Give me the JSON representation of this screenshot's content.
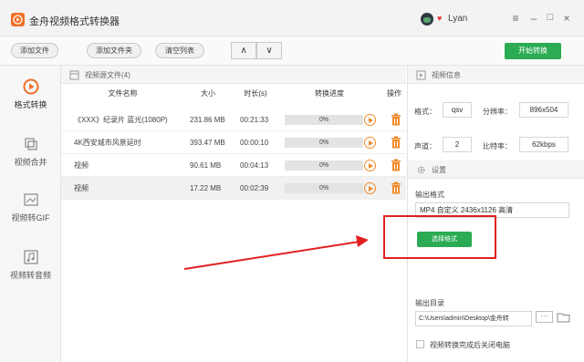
{
  "app": {
    "title": "金舟视频格式转换器",
    "user_name": "Lyan",
    "vip_icon": "heart-icon"
  },
  "window_controls": {
    "menu": "≡",
    "minimize": "–",
    "maximize": "□",
    "close": "×"
  },
  "toolbar": {
    "add_file": "添加文件",
    "add_folder": "添加文件夹",
    "clear_list": "清空列表",
    "move_up": "∧",
    "move_down": "∨",
    "start_convert": "开始转换"
  },
  "sidebar": {
    "items": [
      {
        "label": "格式转换",
        "icon": "play-circle-icon",
        "active": true
      },
      {
        "label": "视频合并",
        "icon": "merge-icon",
        "active": false
      },
      {
        "label": "视频转GIF",
        "icon": "gif-icon",
        "active": false
      },
      {
        "label": "视频转音频",
        "icon": "music-icon",
        "active": false
      }
    ]
  },
  "file_list": {
    "header": "视频源文件(4)",
    "columns": [
      "文件名称",
      "大小",
      "时长(s)",
      "转换进度",
      "操作"
    ],
    "rows": [
      {
        "name": "《XXX》纪录片 蓝光(1080P)",
        "size": "231.86 MB",
        "duration": "00:21:33",
        "progress": "0%",
        "progress_value": 0
      },
      {
        "name": "4K西安城市风景延时",
        "size": "393.47 MB",
        "duration": "00:00:10",
        "progress": "0%",
        "progress_value": 0
      },
      {
        "name": "视频",
        "size": "90.61 MB",
        "duration": "00:04:13",
        "progress": "0%",
        "progress_value": 0
      },
      {
        "name": "视频",
        "size": "17.22 MB",
        "duration": "00:02:39",
        "progress": "0%",
        "progress_value": 0,
        "selected": true
      }
    ]
  },
  "video_info": {
    "header": "视频信息",
    "format_label": "格式：",
    "format_value": "qsv",
    "resolution_label": "分辨率：",
    "resolution_value": "896x504",
    "channel_label": "声道：",
    "channel_value": "2",
    "bitrate_label": "比特率：",
    "bitrate_value": "62kbps"
  },
  "settings": {
    "header": "设置",
    "output_format_label": "输出格式",
    "output_format_value": "MP4 自定义 2436x1126 高清",
    "choose_format": "选择格式",
    "output_dir_label": "输出目录",
    "output_dir_value": "C:\\Users\\admin\\Desktop\\金舟转",
    "browse": "···",
    "shutdown_label": "视频转换完成后关闭电脑"
  },
  "colors": {
    "accent_green": "#2bab54",
    "accent_orange": "#f07028",
    "annotation_red": "#e02020"
  }
}
